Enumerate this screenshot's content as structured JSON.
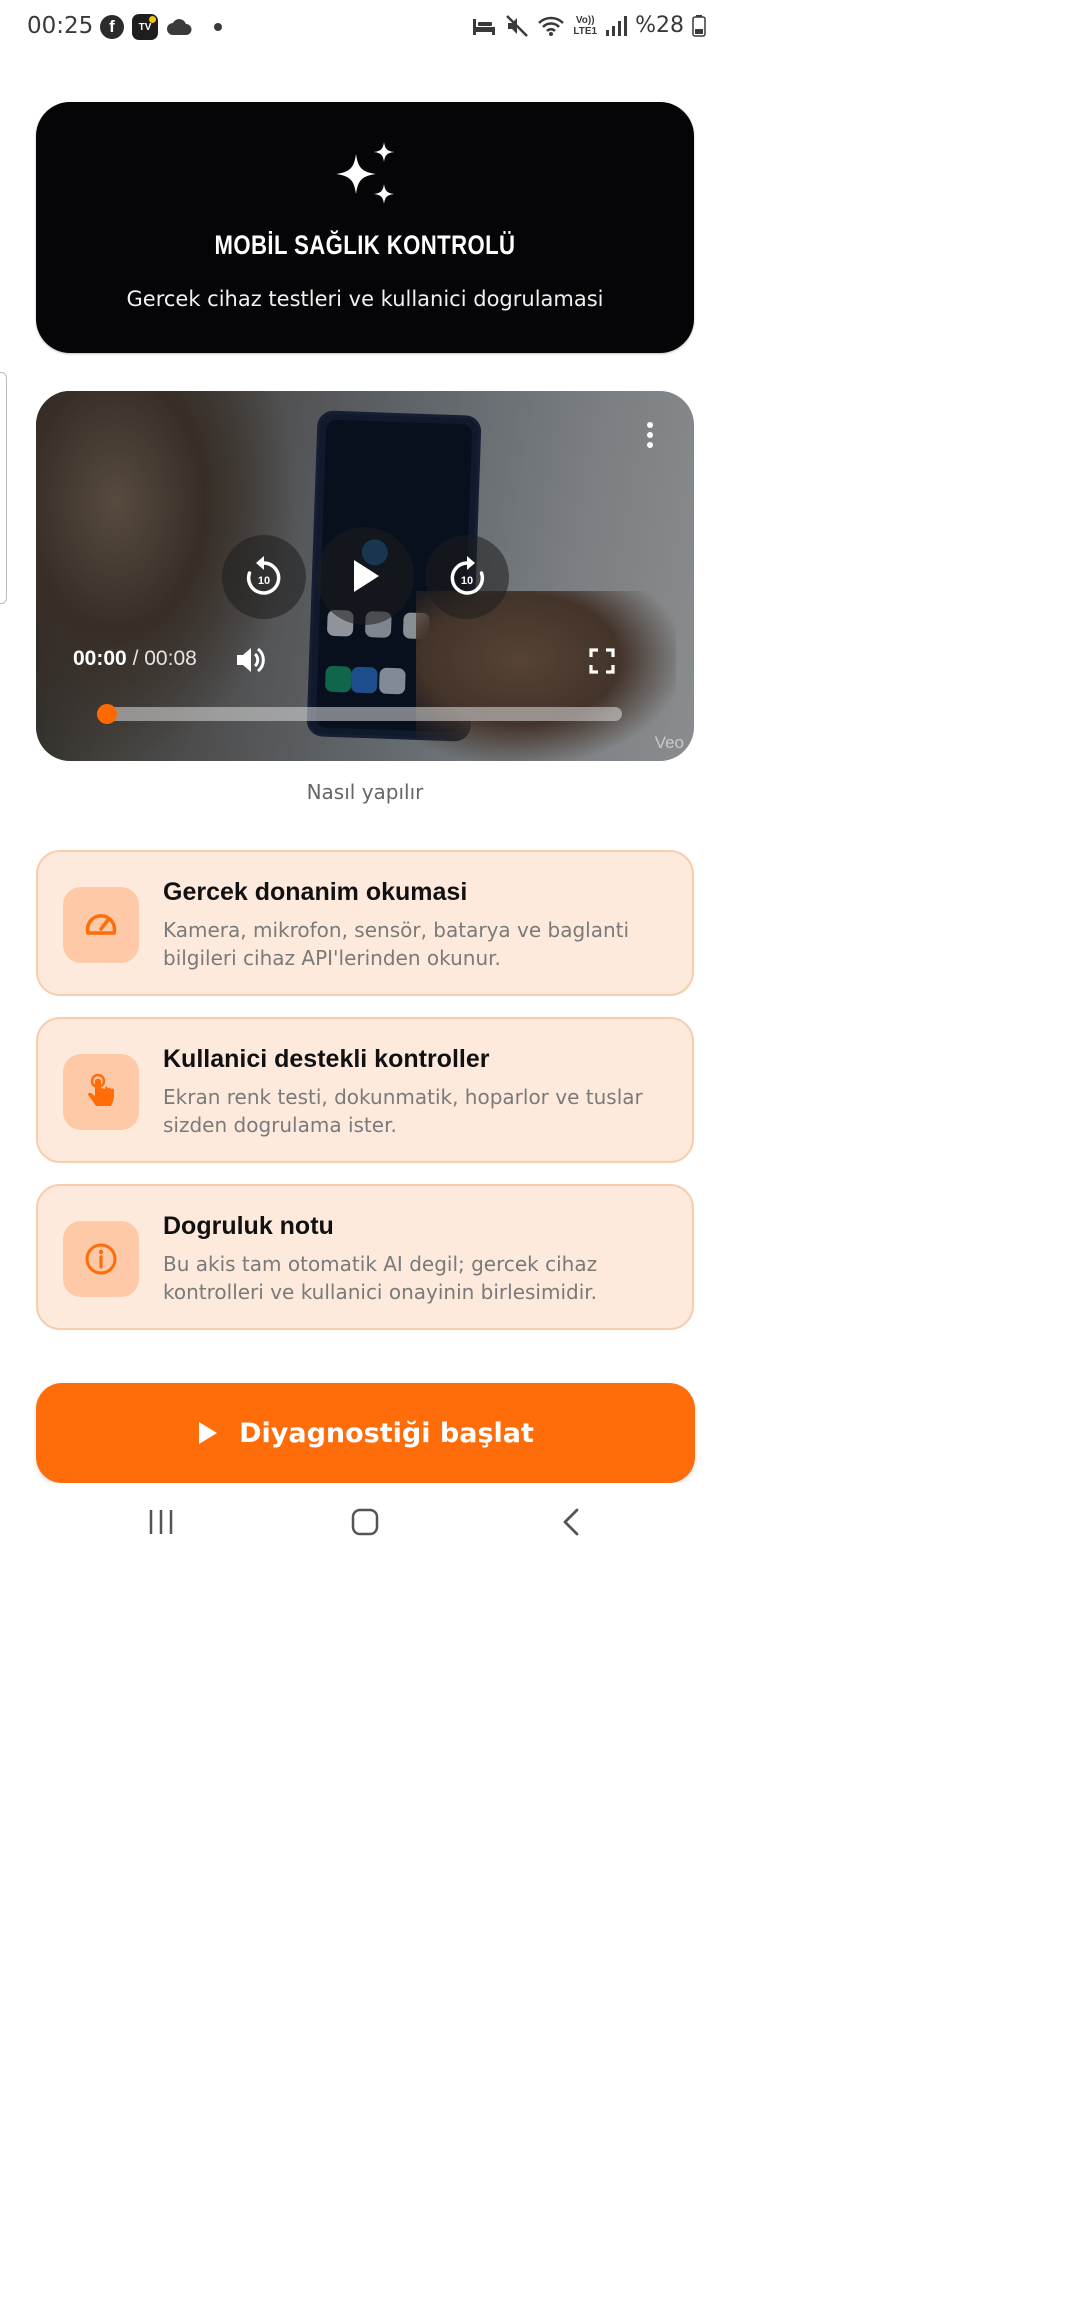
{
  "status_bar": {
    "time": "00:25",
    "left_icons": [
      "facebook-icon",
      "tv-plus-icon",
      "cloud-icon"
    ],
    "facebook_glyph": "f",
    "tv_glyph": "TV",
    "lte_top": "Vo))",
    "lte_bottom": "LTE1",
    "battery": "%28"
  },
  "hero": {
    "title": "MOBİL SAĞLIK KONTROLÜ",
    "subtitle": "Gercek cihaz testleri ve kullanici dogrulamasi"
  },
  "video": {
    "current_time": "00:00",
    "separator": "/",
    "duration": "00:08",
    "rewind_seconds": "10",
    "forward_seconds": "10",
    "progress": 0,
    "watermark": "Veo",
    "caption": "Nasıl yapılır"
  },
  "cards": [
    {
      "icon": "speedometer-icon",
      "title": "Gercek donanim okumasi",
      "description": "Kamera, mikrofon, sensör, batarya ve baglanti bilgileri cihaz API'lerinden okunur."
    },
    {
      "icon": "touch-icon",
      "title": "Kullanici destekli kontroller",
      "description": "Ekran renk testi, dokunmatik, hoparlor ve tuslar sizden dogrulama ister."
    },
    {
      "icon": "info-icon",
      "title": "Dogruluk notu",
      "description": "Bu akis tam otomatik AI degil; gercek cihaz kontrolleri ve kullanici onayinin birlesimidir."
    }
  ],
  "start_button": {
    "label": "Diyagnostiği başlat"
  },
  "colors": {
    "accent": "#ff6c0a",
    "card_bg": "#fdeadd",
    "card_border": "#f8cdae",
    "hero_bg": "#050507"
  }
}
